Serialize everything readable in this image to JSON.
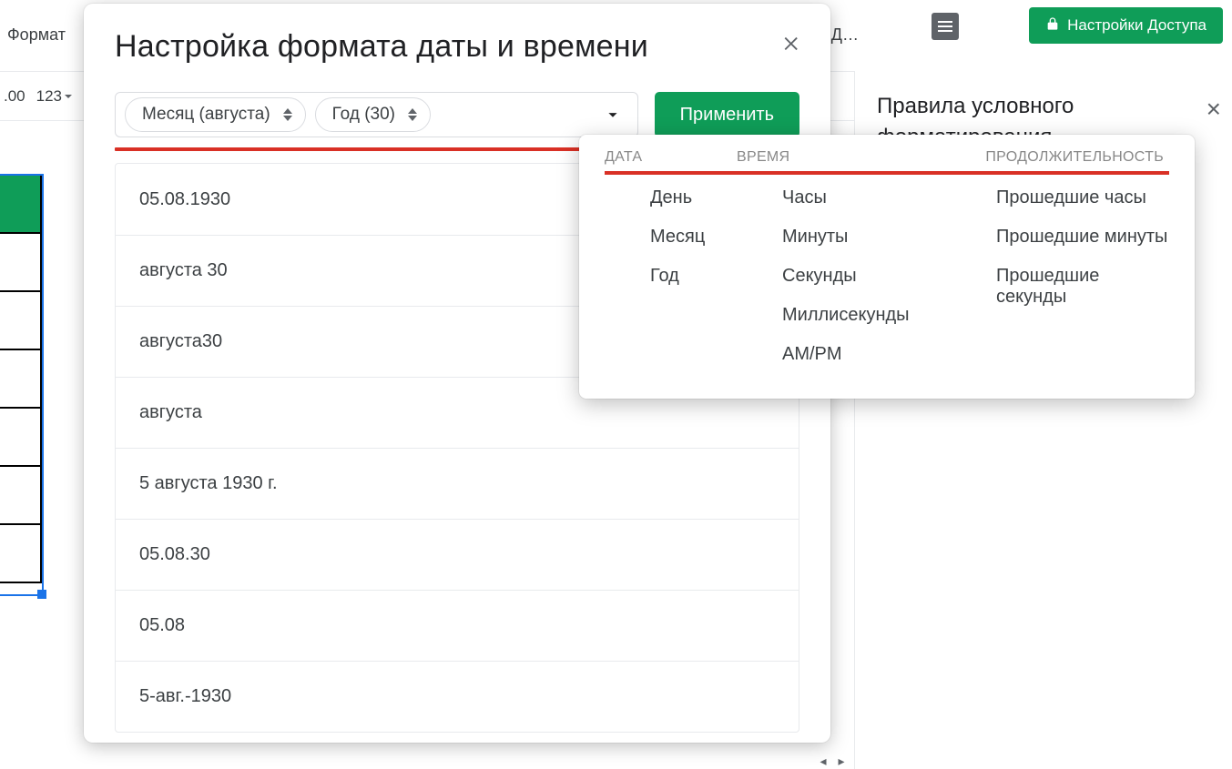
{
  "app": {
    "menu_format": "Формат",
    "truncated_label": "а Д…",
    "share_button": "Настройки Доступа",
    "toolbar_num": ".00",
    "toolbar_123": "123"
  },
  "sidepanel": {
    "title": "Правила условного форматирования"
  },
  "dialog": {
    "title": "Настройка формата даты и времени",
    "chip_month": "Месяц (августа)",
    "chip_year": "Год (30)",
    "apply": "Применить",
    "formats": [
      "05.08.1930",
      "августа 30",
      "августа30",
      "августа",
      "5 августа 1930 г.",
      "05.08.30",
      "05.08",
      "5-авг.-1930"
    ]
  },
  "dropdown": {
    "headers": {
      "date": "ДАТА",
      "time": "ВРЕМЯ",
      "duration": "ПРОДОЛЖИТЕЛЬНОСТЬ"
    },
    "col_date": [
      "День",
      "Месяц",
      "Год"
    ],
    "col_time": [
      "Часы",
      "Минуты",
      "Секунды",
      "Миллисекунды",
      "AM/PM"
    ],
    "col_duration": [
      "Прошедшие часы",
      "Прошедшие минуты",
      "Прошедшие секунды"
    ]
  }
}
